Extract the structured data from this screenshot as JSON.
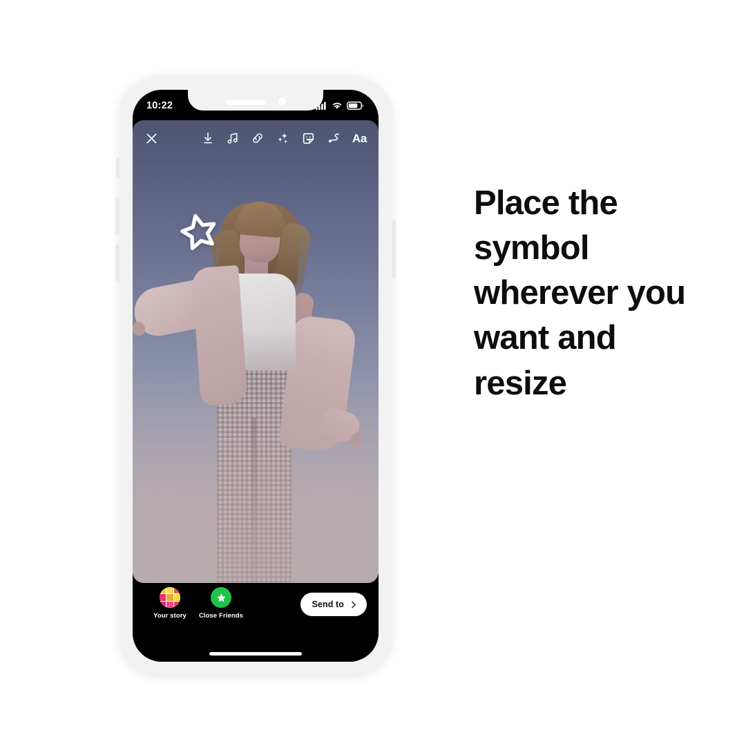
{
  "headline": {
    "text": "Place the symbol wherever you want and resize"
  },
  "phone": {
    "status_bar": {
      "time": "10:22",
      "icons": [
        "cellular-signal-icon",
        "wifi-icon",
        "battery-icon"
      ]
    },
    "home_indicator": "home-indicator"
  },
  "story_editor": {
    "toolbar": {
      "close_label": "close-icon",
      "tools": [
        {
          "name": "download-icon",
          "label": "Save"
        },
        {
          "name": "music-icon",
          "label": "Music"
        },
        {
          "name": "link-icon",
          "label": "Link"
        },
        {
          "name": "sparkles-icon",
          "label": "Effects"
        },
        {
          "name": "sticker-icon",
          "label": "Stickers"
        },
        {
          "name": "draw-icon",
          "label": "Draw"
        },
        {
          "name": "text-icon",
          "label": "Aa"
        }
      ],
      "text_tool_label": "Aa"
    },
    "sticker": {
      "name": "star-sticker",
      "shape": "star-outline",
      "color": "#ffffff",
      "rotation": "-13deg"
    },
    "canvas": {
      "description": "Photo of a woman standing against a dusk sky",
      "sky_top_color": "#4e5571",
      "sky_bottom_color": "#a8a3a8"
    },
    "bottom_bar": {
      "destinations": [
        {
          "name": "your-story",
          "label": "Your story",
          "icon": "story-grid-avatar"
        },
        {
          "name": "close-friends",
          "label": "Close Friends",
          "icon": "green-star-icon",
          "color": "#1fc24b"
        }
      ],
      "send_button": {
        "label": "Send to",
        "icon": "chevron-right-icon"
      }
    }
  },
  "avatar_grid_colors": [
    "#f4c63d",
    "#f0e14a",
    "#e8565f",
    "#e8346e",
    "#f2a33c",
    "#f5d93f",
    "#d92a7a",
    "#ec4a86",
    "#e8466a"
  ],
  "theme": {
    "page_background": "#ffffff",
    "frame_color": "#f2f2f2",
    "screen_black": "#000000",
    "text_color": "#0d0d0d",
    "accent_green": "#1fc24b"
  }
}
